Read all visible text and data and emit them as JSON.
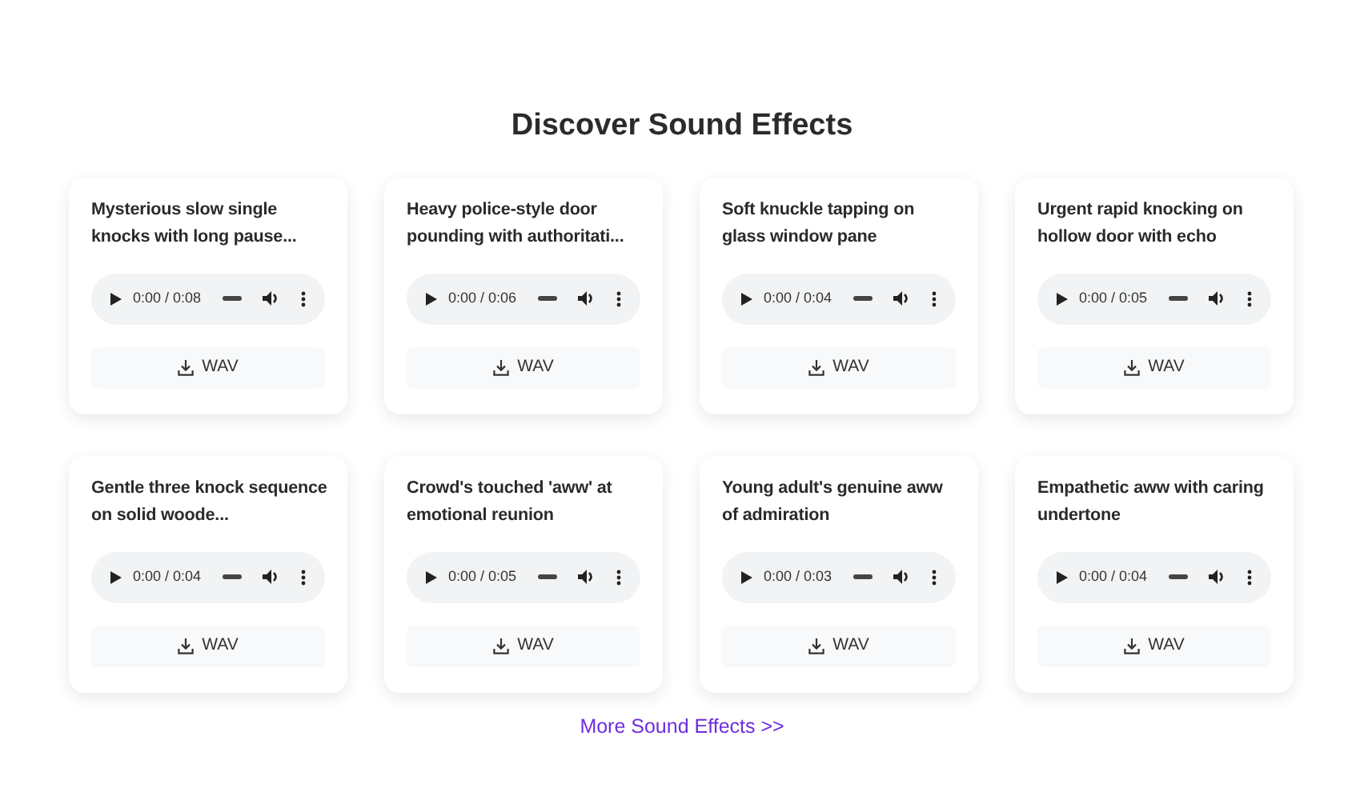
{
  "heading": "Discover Sound Effects",
  "sounds": [
    {
      "title": "Mysterious slow single knocks with long pause...",
      "time": "0:00 / 0:08",
      "download": "WAV"
    },
    {
      "title": "Heavy police-style door pounding with authoritati...",
      "time": "0:00 / 0:06",
      "download": "WAV"
    },
    {
      "title": "Soft knuckle tapping on glass window pane",
      "time": "0:00 / 0:04",
      "download": "WAV"
    },
    {
      "title": "Urgent rapid knocking on hollow door with echo",
      "time": "0:00 / 0:05",
      "download": "WAV"
    },
    {
      "title": "Gentle three knock sequence on solid woode...",
      "time": "0:00 / 0:04",
      "download": "WAV"
    },
    {
      "title": "Crowd's touched 'aww' at emotional reunion",
      "time": "0:00 / 0:05",
      "download": "WAV"
    },
    {
      "title": "Young adult's genuine aww of admiration",
      "time": "0:00 / 0:03",
      "download": "WAV"
    },
    {
      "title": "Empathetic aww with caring undertone",
      "time": "0:00 / 0:04",
      "download": "WAV"
    }
  ],
  "more_link": "More Sound Effects >>"
}
